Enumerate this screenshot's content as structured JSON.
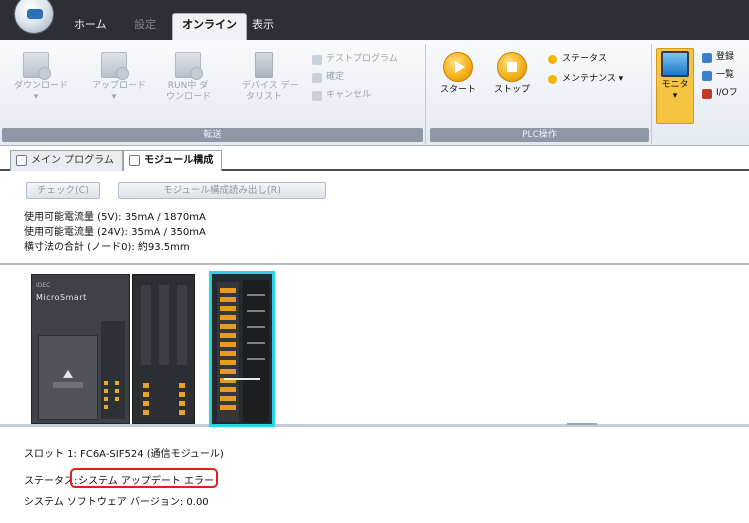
{
  "ribbon": {
    "tabs": [
      "ホーム",
      "設定",
      "オンライン",
      "表示"
    ],
    "active_tab": "オンライン",
    "groups": {
      "transfer": {
        "label": "転送",
        "buttons": [
          "ダウンロード",
          "アップロード",
          "RUN中ダウンロード",
          "デバイスデータリスト"
        ],
        "download": {
          "line1": "ダウンロード",
          "line2": "▾"
        },
        "upload": {
          "line1": "アップロード",
          "line2": "▾"
        },
        "run_download": {
          "line1": "RUN中 ダ",
          "line2": "ウンロード"
        },
        "device_data": {
          "line1": "デバイス デー",
          "line2": "タリスト"
        },
        "test_program": "テストプログラム",
        "confirm": "確定",
        "cancel": "キャンセル"
      },
      "plc": {
        "label": "PLC操作",
        "start": "スタート",
        "stop": "ストップ",
        "status": "ステータス",
        "maintenance": "メンテナンス ▾"
      },
      "monitor": {
        "label": "",
        "monitor": "モニタ",
        "monitor_sub": "▾",
        "item1": "登録",
        "item2": "一覧",
        "item3": "I/Oフ"
      }
    }
  },
  "doc_tabs": {
    "main_program": "メイン プログラム",
    "module_config": "モジュール構成"
  },
  "config": {
    "check_button": "チェック(C)",
    "read_config_button": "モジュール構成読み出し(R)",
    "current_5v": "使用可能電流量 (5V): 35mA / 1870mA",
    "current_24v": "使用可能電流量 (24V): 35mA / 350mA",
    "width_total": "横寸法の合計 (ノード0): 約93.5mm"
  },
  "canvas": {
    "cpu_brand": "MicroSmart",
    "cpu_sub": "IDEC"
  },
  "status": {
    "slot": "スロット 1: FC6A-SIF524 (通信モジュール)",
    "status_label": "ステータス:",
    "status_value": "システム アップデート エラー",
    "system_version": "システム ソフトウェア バージョン: 0.00"
  },
  "colors": {
    "selected_module_border": "#29d4e0",
    "error_highlight": "#e02020",
    "ribbon_dark": "#2c2f34"
  }
}
